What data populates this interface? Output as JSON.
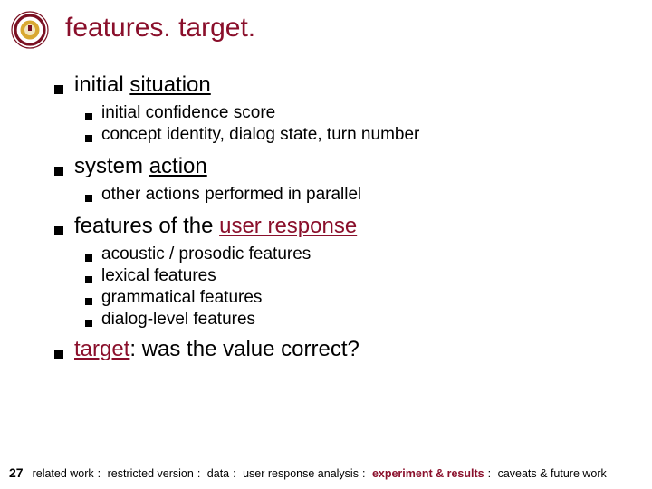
{
  "title": "features. target.",
  "sections": [
    {
      "label_a": "initial ",
      "label_b": "situation",
      "items": [
        "initial confidence score",
        "concept identity, dialog state, turn number"
      ]
    },
    {
      "label_a": "system ",
      "label_b": "action",
      "items": [
        "other actions performed in parallel"
      ]
    },
    {
      "label_a": "features of the ",
      "label_b": "user response",
      "accent": true,
      "items": [
        "acoustic / prosodic features",
        "lexical features",
        "grammatical features",
        "dialog-level features"
      ]
    }
  ],
  "target_line": {
    "underlined": "target",
    "rest": ": was the value correct?"
  },
  "page_number": "27",
  "breadcrumb": [
    {
      "text": "related work",
      "bold": false
    },
    {
      "text": "restricted version",
      "bold": false
    },
    {
      "text": "data",
      "bold": false
    },
    {
      "text": "user response analysis",
      "bold": false
    },
    {
      "text": "experiment & results",
      "bold": true
    },
    {
      "text": "caveats & future work",
      "bold": false
    }
  ]
}
